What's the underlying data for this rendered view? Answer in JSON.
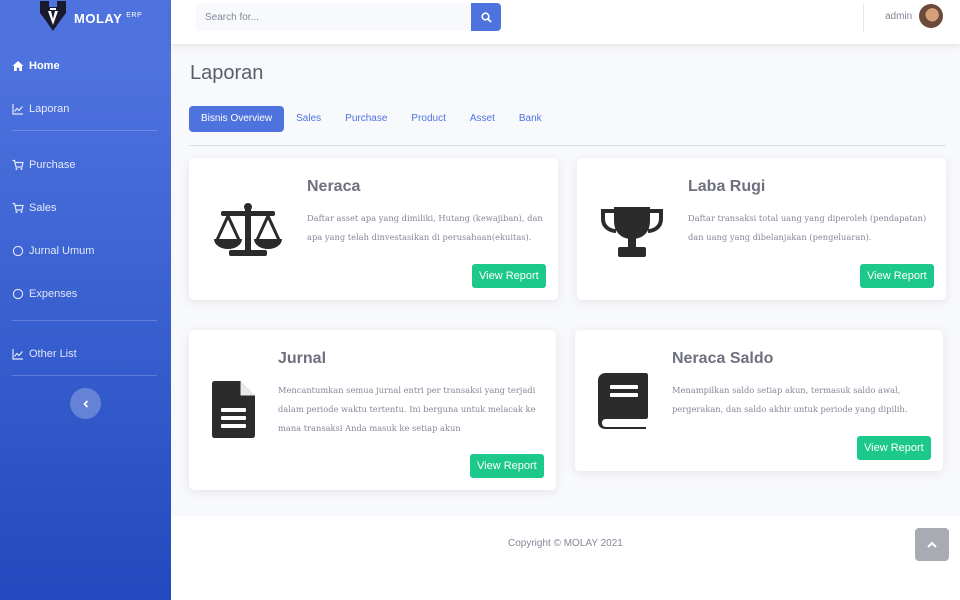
{
  "brand": {
    "name": "MOLAY",
    "suffix": "ERP"
  },
  "sidebar": {
    "items": [
      {
        "label": "Home",
        "icon": "home-icon"
      },
      {
        "label": "Laporan",
        "icon": "chart-line-icon"
      },
      {
        "label": "Purchase",
        "icon": "cart-icon"
      },
      {
        "label": "Sales",
        "icon": "cart-icon"
      },
      {
        "label": "Jurnal Umum",
        "icon": "circle-icon"
      },
      {
        "label": "Expenses",
        "icon": "circle-icon"
      },
      {
        "label": "Other List",
        "icon": "chart-line-icon"
      }
    ]
  },
  "search": {
    "placeholder": "Search for..."
  },
  "user": {
    "name": "admin"
  },
  "page": {
    "title": "Laporan"
  },
  "tabs": [
    {
      "label": "Bisnis Overview",
      "active": true
    },
    {
      "label": "Sales"
    },
    {
      "label": "Purchase"
    },
    {
      "label": "Product"
    },
    {
      "label": "Asset"
    },
    {
      "label": "Bank"
    }
  ],
  "cards": [
    {
      "title": "Neraca",
      "description": "Daftar asset apa yang dimiliki, Hutang (kewajiban), dan apa yang telah dinvestasikan di perusahaan(ekuitas).",
      "button": "View Report",
      "icon": "balance-scale-icon"
    },
    {
      "title": "Laba Rugi",
      "description": "Daftar transaksi total uang yang diperoleh (pendapatan) dan uang yang dibelanjakan (pengeluaran).",
      "button": "View Report",
      "icon": "trophy-icon"
    },
    {
      "title": "Jurnal",
      "description": "Mencantumkan semua jurnal entri per transaksi yang terjadi dalam periode waktu tertentu. Ini berguna untuk melacak ke mana transaksi Anda masuk ke setiap akun",
      "button": "View Report",
      "icon": "file-alt-icon"
    },
    {
      "title": "Neraca Saldo",
      "description": "Menampilkan saldo setiap akun, termasuk saldo awal, pergerakan, dan saldo akhir untuk periode yang dipilih.",
      "button": "View Report",
      "icon": "book-icon"
    }
  ],
  "footer": {
    "copyright": "Copyright © MOLAY 2021"
  },
  "colors": {
    "primary": "#4e73df",
    "success": "#1cc88a"
  }
}
